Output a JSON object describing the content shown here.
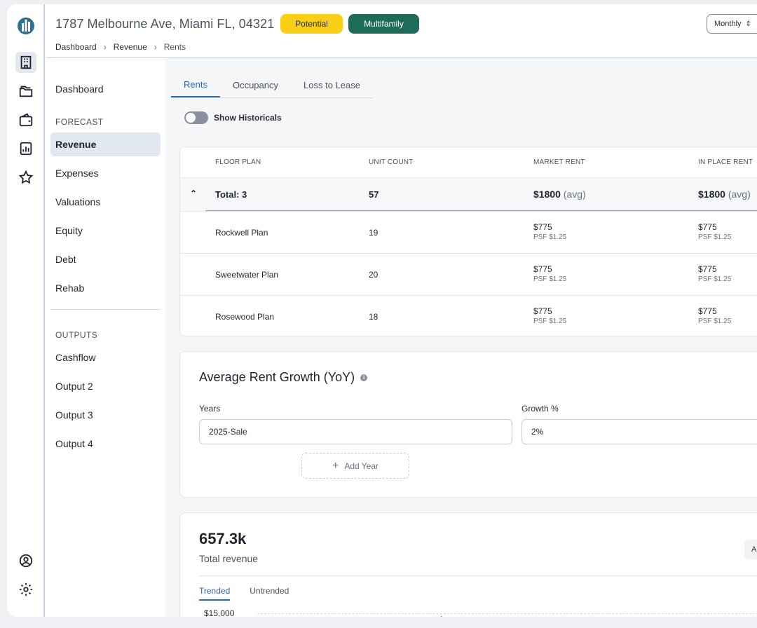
{
  "header": {
    "address": "1787 Melbourne Ave, Miami FL, 04321",
    "badges": {
      "potential": "Potential",
      "multifamily": "Multifamily"
    },
    "breadcrumb": [
      "Dashboard",
      "Revenue",
      "Rents"
    ],
    "period_select": "Monthly"
  },
  "rail": {
    "icons": [
      "logo-icon",
      "building-icon",
      "folder-icon",
      "wallet-icon",
      "report-icon",
      "star-icon",
      "user-circle-icon",
      "gear-icon"
    ]
  },
  "sidebar": {
    "dashboard": "Dashboard",
    "forecast_heading": "FORECAST",
    "forecast_items": [
      "Revenue",
      "Expenses",
      "Valuations",
      "Equity",
      "Debt",
      "Rehab"
    ],
    "outputs_heading": "OUTPUTS",
    "output_items": [
      "Cashflow",
      "Output 2",
      "Output 3",
      "Output 4"
    ]
  },
  "tabs": [
    "Rents",
    "Occupancy",
    "Loss to Lease"
  ],
  "toggle": {
    "label": "Show Historicals",
    "on": false
  },
  "table": {
    "headers": [
      "FLOOR PLAN",
      "UNIT COUNT",
      "MARKET RENT",
      "IN PLACE RENT"
    ],
    "total": {
      "label": "Total: 3",
      "units": "57",
      "market": "$1800",
      "inplace": "$1800",
      "avg": "(avg)"
    },
    "rows": [
      {
        "plan": "Rockwell Plan",
        "units": "19",
        "market": "$775",
        "market_psf": "PSF $1.25",
        "inplace": "$775",
        "inplace_psf": "PSF $1.25"
      },
      {
        "plan": "Sweetwater Plan",
        "units": "20",
        "market": "$775",
        "market_psf": "PSF $1.25",
        "inplace": "$775",
        "inplace_psf": "PSF $1.25"
      },
      {
        "plan": "Rosewood Plan",
        "units": "18",
        "market": "$775",
        "market_psf": "PSF $1.25",
        "inplace": "$775",
        "inplace_psf": "PSF $1.25"
      }
    ]
  },
  "growth": {
    "title": "Average Rent Growth (YoY)",
    "years_label": "Years",
    "years_value": "2025-Sale",
    "growth_label": "Growth %",
    "growth_value": "2%",
    "add_year": "Add Year"
  },
  "revenue": {
    "total": "657.3k",
    "label": "Total revenue",
    "tabs": [
      "Trended",
      "Untrended"
    ],
    "y_tick": "$15,000",
    "button": "A"
  },
  "colors": {
    "accent": "#2d67b5",
    "potential": "#f8cf16",
    "multifamily": "#1d6b58"
  }
}
